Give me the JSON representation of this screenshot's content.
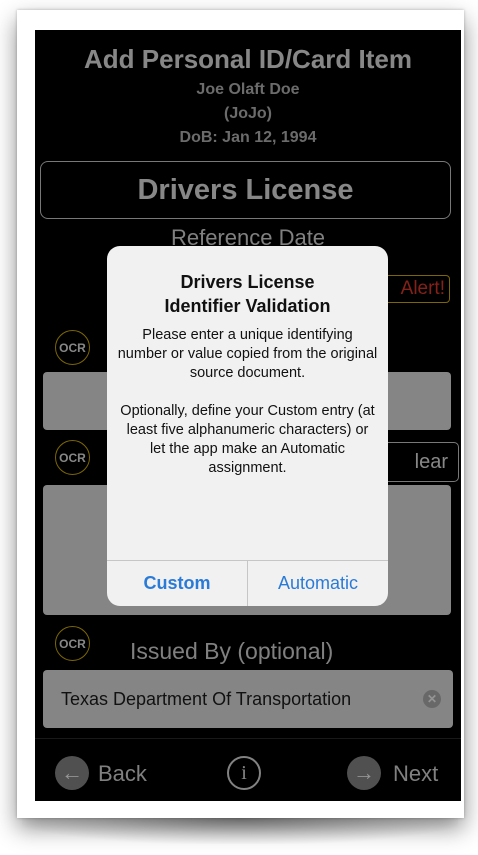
{
  "header": {
    "title": "Add Personal ID/Card Item",
    "name": "Joe Olaft Doe",
    "nickname": "(JoJo)",
    "dob": "DoB: Jan 12, 1994"
  },
  "card_type": "Drivers License",
  "reference_date_label": "Reference Date",
  "alert_badge": "Alert!",
  "ocr_label": "OCR",
  "clear_label": "lear",
  "issued_by": {
    "label": "Issued By (optional)",
    "value": "Texas Department Of Transportation"
  },
  "toolbar": {
    "back": "Back",
    "info": "i",
    "next": "Next"
  },
  "dialog": {
    "title": "Drivers License\nIdentifier Validation",
    "message": "Please enter a unique identifying number or value copied from the original source document.\n\nOptionally, define your Custom entry (at least five alphanumeric characters) or let the app make an Automatic assignment.",
    "custom_button": "Custom",
    "automatic_button": "Automatic"
  },
  "colors": {
    "accent_blue": "#2a7bd8",
    "alert_red": "#e53a2a",
    "ocr_ring": "#d8b200"
  }
}
